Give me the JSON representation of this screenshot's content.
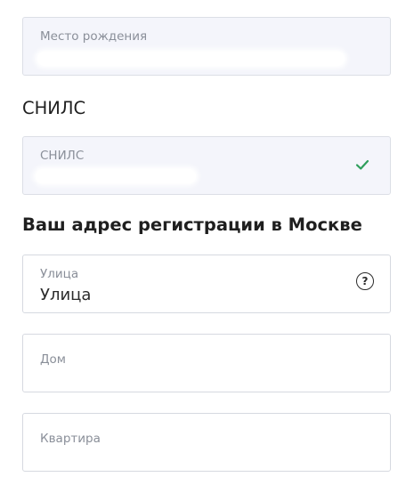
{
  "birthplace": {
    "label": "Место рождения"
  },
  "snils_section": {
    "title": "СНИЛС"
  },
  "snils_field": {
    "label": "СНИЛС",
    "status_icon": "check-icon",
    "status_color": "#2e9e5b"
  },
  "address_section": {
    "title": "Ваш адрес регистрации в Москве"
  },
  "street": {
    "label": "Улица",
    "value": "Улица",
    "help_icon": "question-icon",
    "help_glyph": "?"
  },
  "house": {
    "label": "Дом"
  },
  "apartment": {
    "label": "Квартира"
  }
}
